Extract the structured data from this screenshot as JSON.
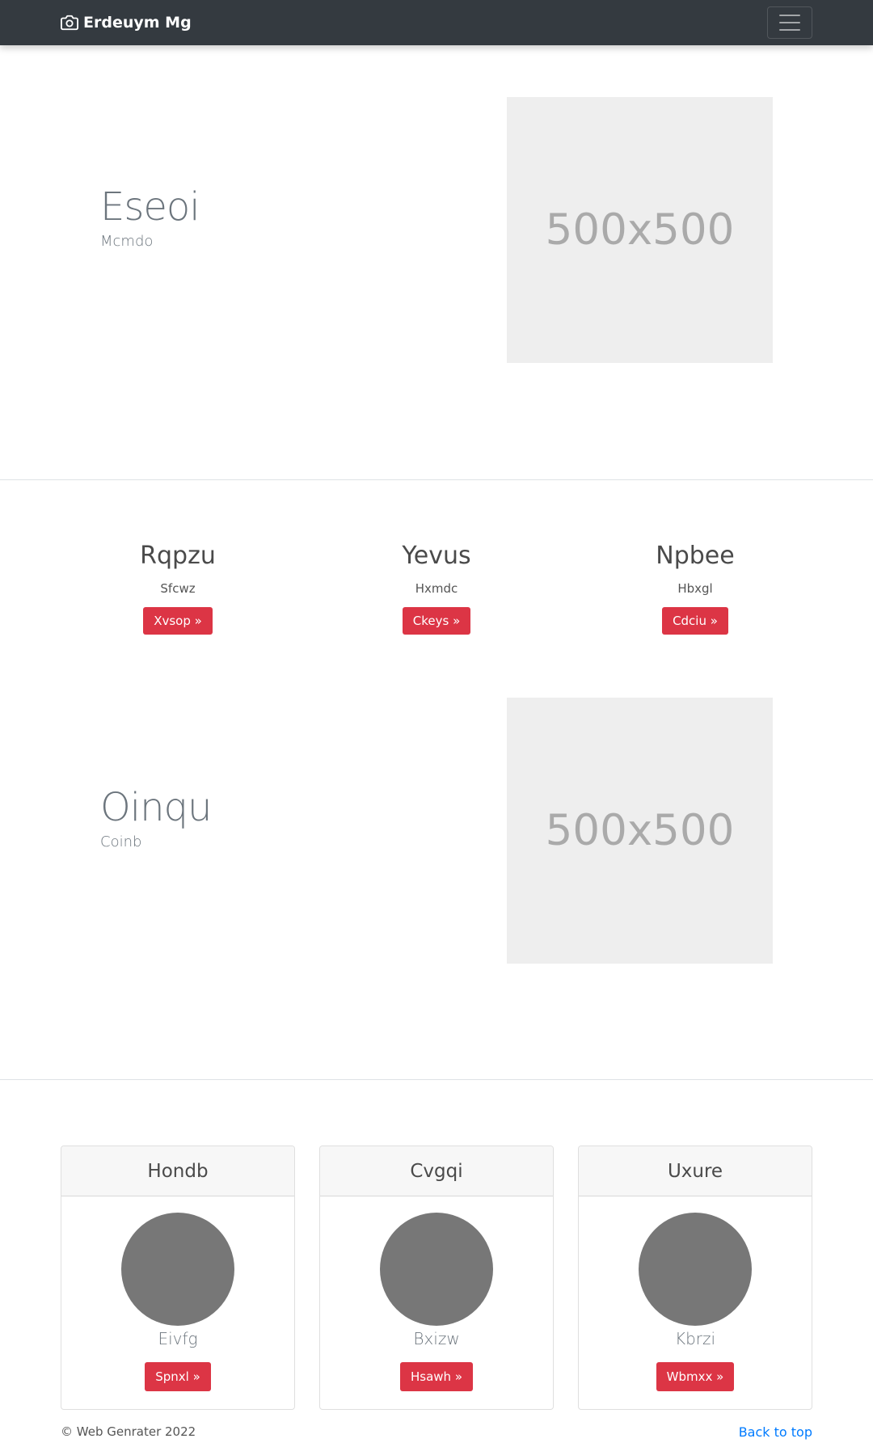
{
  "navbar": {
    "brand": "Erdeuym Mg",
    "brand_icon": "camera-icon",
    "toggler_icon": "hamburger-icon"
  },
  "feature1": {
    "heading": "Eseoi",
    "subheading": "Mcmdo",
    "image_label": "500x500"
  },
  "columns": [
    {
      "heading": "Rqpzu",
      "text": "Sfcwz",
      "button": "Xvsop »"
    },
    {
      "heading": "Yevus",
      "text": "Hxmdc",
      "button": "Ckeys »"
    },
    {
      "heading": "Npbee",
      "text": "Hbxgl",
      "button": "Cdciu »"
    }
  ],
  "feature2": {
    "heading": "Oinqu",
    "subheading": "Coinb",
    "image_label": "500x500"
  },
  "cards": [
    {
      "header": "Hondb",
      "text": "Eivfg",
      "button": "Spnxl »"
    },
    {
      "header": "Cvgqi",
      "text": "Bxizw",
      "button": "Hsawh »"
    },
    {
      "header": "Uxure",
      "text": "Kbrzi",
      "button": "Wbmxx »"
    }
  ],
  "footer": {
    "copyright": "© Web Genrater 2022",
    "back_to_top": "Back to top"
  },
  "colors": {
    "navbar_bg": "#343a40",
    "button_danger": "#dc3545",
    "link": "#007bff",
    "avatar": "#777777",
    "placeholder_bg": "#eeeeee"
  }
}
